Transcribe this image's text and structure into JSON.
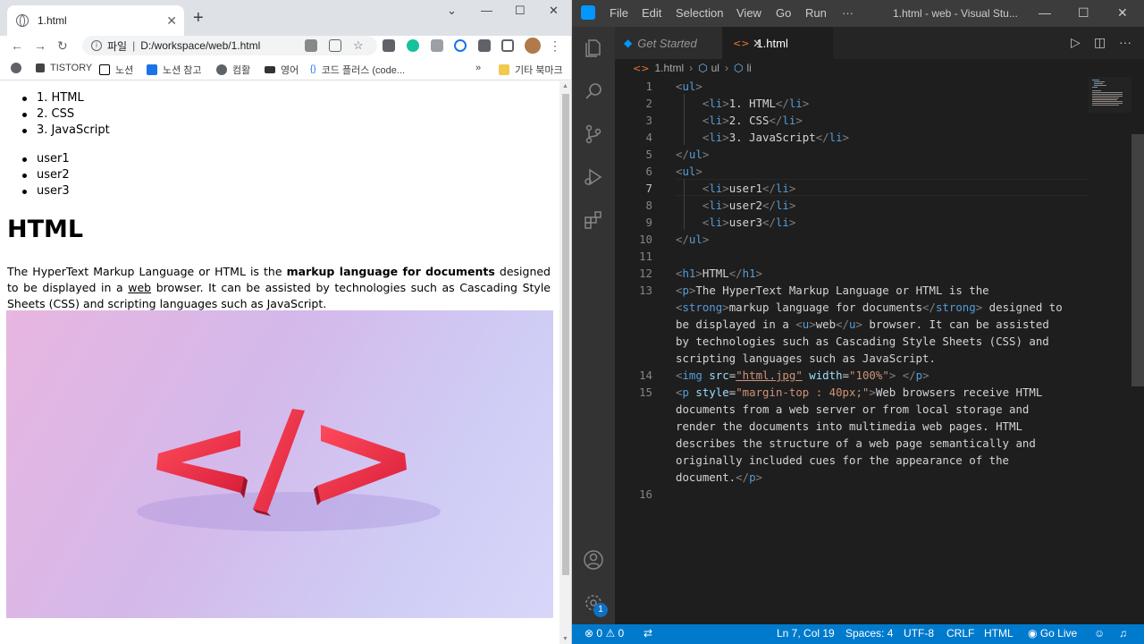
{
  "browser": {
    "tab": {
      "title": "1.html",
      "close": "✕"
    },
    "new_tab": "+",
    "window_buttons": [
      "⌄",
      "—",
      "☐",
      "✕"
    ],
    "nav": {
      "back": "←",
      "forward": "→",
      "reload": "↻"
    },
    "address": {
      "scheme_label": "파일",
      "separator": "|",
      "path": "D:/workspace/web/1.html",
      "info": "i"
    },
    "bookmarks": [
      {
        "label": "",
        "icon": "globe-icon"
      },
      {
        "label": "TISTORY",
        "icon": "tistory-icon"
      },
      {
        "label": "노션",
        "icon": "notion-icon"
      },
      {
        "label": "노션 참고",
        "icon": "number-one-icon"
      },
      {
        "label": "컴활",
        "icon": "globe-icon"
      },
      {
        "label": "영어",
        "icon": "tt-icon"
      },
      {
        "label": "코드 플러스 (code...",
        "icon": "code-icon"
      }
    ],
    "bookmarks_overflow": "»",
    "other_bookmarks": "기타 북마크",
    "page": {
      "list1": [
        "1. HTML",
        "2. CSS",
        "3. JavaScript"
      ],
      "list2": [
        "user1",
        "user2",
        "user3"
      ],
      "heading": "HTML",
      "para": {
        "t1": "The HyperText Markup Language or HTML is the ",
        "strong": "markup language for documents",
        "t2": " designed to be displayed in a ",
        "u": "web",
        "t3": " browser. It can be assisted by technologies such as Cascading Style Sheets (CSS) and scripting languages such as JavaScript."
      }
    }
  },
  "vscode": {
    "menu": [
      "File",
      "Edit",
      "Selection",
      "View",
      "Go",
      "Run",
      "···"
    ],
    "title": "1.html - web - Visual Stu...",
    "window_buttons": [
      "—",
      "☐",
      "✕"
    ],
    "tabs": [
      {
        "label": "Get Started",
        "icon": "vscode-icon"
      },
      {
        "label": "1.html",
        "icon": "html-chevron-icon",
        "close": "✕"
      }
    ],
    "breadcrumb": [
      "1.html",
      "ul",
      "li"
    ],
    "line_numbers": [
      "1",
      "2",
      "3",
      "4",
      "5",
      "6",
      "7",
      "8",
      "9",
      "10",
      "11",
      "12",
      "13",
      "14",
      "15",
      "16"
    ],
    "current_line": "7",
    "code": {
      "l1": "ul",
      "l2": "1. HTML",
      "l3": "2. CSS",
      "l4": "3. JavaScript",
      "l5": "ul",
      "l6": "ul",
      "l7": "user1",
      "l8": "user2",
      "l9": "user3",
      "l10": "ul",
      "l12": "HTML",
      "l13a": "The HyperText Markup Language or HTML is the",
      "l13b_strong": "markup language for documents",
      "l13b_rest": " designed to",
      "l13c_a": "be displayed in a ",
      "l13c_u": "web",
      "l13c_b": " browser. It can be assisted",
      "l13d": "by technologies such as Cascading Style Sheets (CSS) and",
      "l13e": "scripting languages such as JavaScript.",
      "l14_src": "\"html.jpg\"",
      "l14_width": "\"100%\"",
      "l15_style": "\"margin-top : 40px;\"",
      "l15a": "Web browsers receive HTML",
      "l15b": "documents from a web server or from local storage and",
      "l15c": "render the documents into multimedia web pages. HTML",
      "l15d": "describes the structure of a web page semantically and",
      "l15e": "originally included cues for the appearance of the",
      "l15f": "document."
    },
    "status": {
      "errors": "0",
      "warnings": "0",
      "position": "Ln 7, Col 19",
      "spaces": "Spaces: 4",
      "encoding": "UTF-8",
      "eol": "CRLF",
      "language": "HTML",
      "golive": "Go Live"
    },
    "accounts_badge": "1",
    "colors": {
      "accent": "#007acc",
      "tag": "#569cd6",
      "attr": "#9cdcfe",
      "string": "#ce9178"
    }
  }
}
